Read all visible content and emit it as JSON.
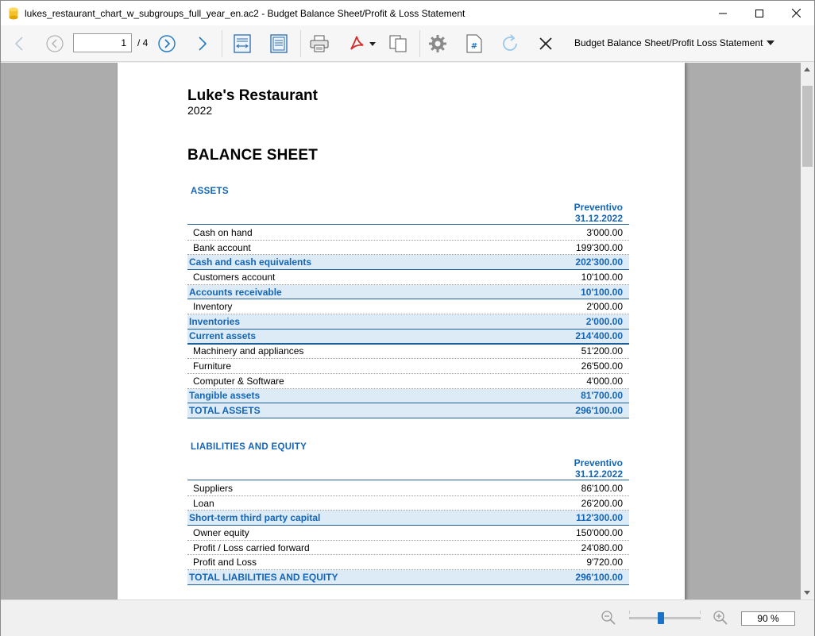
{
  "window": {
    "title": "lukes_restaurant_chart_w_subgroups_full_year_en.ac2 - Budget Balance Sheet/Profit & Loss Statement"
  },
  "toolbar": {
    "page_current": "1",
    "page_total": "/ 4",
    "report_name": "Budget Balance Sheet/Profit  Loss Statement"
  },
  "colors": {
    "accent": "#1565b7",
    "total_row_bg": "#dcebf6",
    "viewer_bg": "#acacac"
  },
  "report": {
    "company": "Luke's Restaurant",
    "year": "2022",
    "title": "BALANCE SHEET",
    "assets": {
      "section": "ASSETS",
      "col_head_1": "Preventivo",
      "col_head_2": "31.12.2022",
      "rows": [
        {
          "label": "Cash on hand",
          "value": "3'000.00",
          "type": "item"
        },
        {
          "label": "Bank account",
          "value": "199'300.00",
          "type": "item"
        },
        {
          "label": "Cash and cash equivalents",
          "value": "202'300.00",
          "type": "total"
        },
        {
          "label": "Customers account",
          "value": "10'100.00",
          "type": "item"
        },
        {
          "label": "Accounts receivable",
          "value": "10'100.00",
          "type": "total"
        },
        {
          "label": "Inventory",
          "value": "2'000.00",
          "type": "item"
        },
        {
          "label": "Inventories",
          "value": "2'000.00",
          "type": "total"
        },
        {
          "label": "Current assets",
          "value": "214'400.00",
          "type": "total"
        },
        {
          "label": "Machinery and appliances",
          "value": "51'200.00",
          "type": "item"
        },
        {
          "label": "Furniture",
          "value": "26'500.00",
          "type": "item"
        },
        {
          "label": "Computer & Software",
          "value": "4'000.00",
          "type": "item"
        },
        {
          "label": "Tangible assets",
          "value": "81'700.00",
          "type": "total"
        },
        {
          "label": "TOTAL ASSETS",
          "value": "296'100.00",
          "type": "total"
        }
      ]
    },
    "liabilities": {
      "section": "LIABILITIES AND EQUITY",
      "col_head_1": "Preventivo",
      "col_head_2": "31.12.2022",
      "rows": [
        {
          "label": "Suppliers",
          "value": "86'100.00",
          "type": "item"
        },
        {
          "label": "Loan",
          "value": "26'200.00",
          "type": "item"
        },
        {
          "label": "Short-term third party capital",
          "value": "112'300.00",
          "type": "total"
        },
        {
          "label": "Owner equity",
          "value": "150'000.00",
          "type": "item"
        },
        {
          "label": "Profit / Loss carried forward",
          "value": "24'080.00",
          "type": "item"
        },
        {
          "label": "Profit and Loss",
          "value": "9'720.00",
          "type": "item"
        },
        {
          "label": "TOTAL LIABILITIES AND EQUITY",
          "value": "296'100.00",
          "type": "total"
        }
      ]
    }
  },
  "status": {
    "zoom": "90  %",
    "zoom_level_percent": 90
  }
}
